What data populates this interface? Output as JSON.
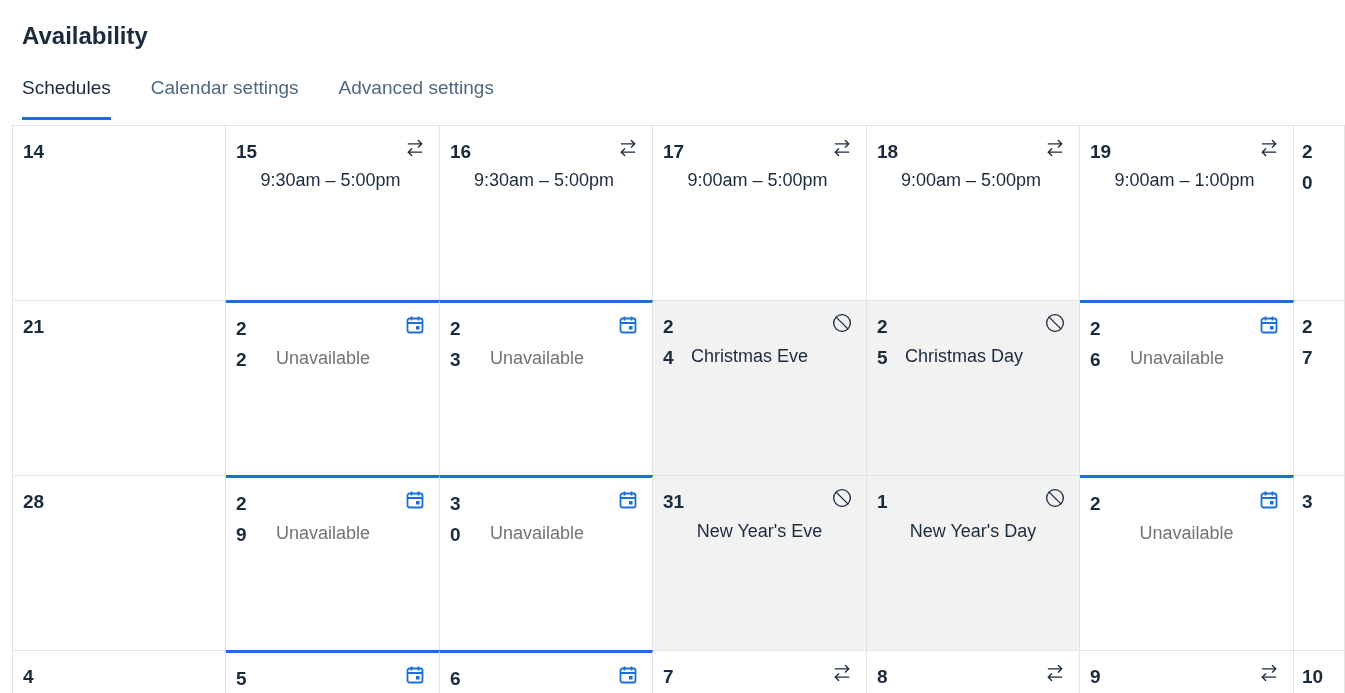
{
  "title": "Availability",
  "tabs": [
    {
      "label": "Schedules",
      "selected": true
    },
    {
      "label": "Calendar settings",
      "selected": false
    },
    {
      "label": "Advanced settings",
      "selected": false
    }
  ],
  "weeks": [
    [
      {
        "day": "14",
        "kind": "empty"
      },
      {
        "day": "15",
        "kind": "schedule",
        "text": "9:30am – 5:00pm"
      },
      {
        "day": "16",
        "kind": "schedule",
        "text": "9:30am – 5:00pm"
      },
      {
        "day": "17",
        "kind": "schedule",
        "text": "9:00am – 5:00pm"
      },
      {
        "day": "18",
        "kind": "schedule",
        "text": "9:00am – 5:00pm"
      },
      {
        "day": "19",
        "kind": "schedule",
        "text": "9:00am – 1:00pm"
      },
      {
        "day": "20",
        "kind": "empty"
      }
    ],
    [
      {
        "day": "21",
        "kind": "empty"
      },
      {
        "day": "22",
        "kind": "unavailable",
        "text": "Unavailable"
      },
      {
        "day": "23",
        "kind": "unavailable",
        "text": "Unavailable"
      },
      {
        "day": "24",
        "kind": "holiday",
        "text": "Christmas Eve"
      },
      {
        "day": "25",
        "kind": "holiday",
        "text": "Christmas Day"
      },
      {
        "day": "26",
        "kind": "unavailable",
        "text": "Unavailable"
      },
      {
        "day": "27",
        "kind": "empty"
      }
    ],
    [
      {
        "day": "28",
        "kind": "empty"
      },
      {
        "day": "29",
        "kind": "unavailable",
        "text": "Unavailable"
      },
      {
        "day": "30",
        "kind": "unavailable",
        "text": "Unavailable"
      },
      {
        "day": "31",
        "kind": "holiday",
        "text": "New Year's Eve"
      },
      {
        "day": "1",
        "kind": "holiday",
        "text": "New Year's Day"
      },
      {
        "day": "2",
        "kind": "unavailable",
        "text": "Unavailable"
      },
      {
        "day": "3",
        "kind": "empty"
      }
    ],
    [
      {
        "day": "4",
        "kind": "empty"
      },
      {
        "day": "5",
        "kind": "unavailable"
      },
      {
        "day": "6",
        "kind": "unavailable"
      },
      {
        "day": "7",
        "kind": "schedule"
      },
      {
        "day": "8",
        "kind": "schedule"
      },
      {
        "day": "9",
        "kind": "schedule"
      },
      {
        "day": "10",
        "kind": "empty"
      }
    ]
  ]
}
